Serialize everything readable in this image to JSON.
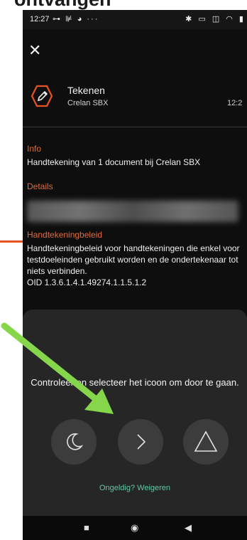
{
  "page": {
    "heading": "ontvangen"
  },
  "status_bar": {
    "time": "12:27",
    "left_icons": "⊶ ⊯ ◕ ···",
    "right_icons": "✱ ▭ ◫ ◠ ▮"
  },
  "request": {
    "title": "Tekenen",
    "subtitle": "Crelan SBX",
    "time": "12:2"
  },
  "info": {
    "label": "Info",
    "text": "Handtekening van 1 document bij Crelan SBX"
  },
  "details": {
    "label": "Details"
  },
  "policy": {
    "label": "Handtekeningbeleid",
    "text": "Handtekeningbeleid voor handtekeningen die enkel voor testdoeleinden gebruikt worden en de ondertekenaar tot niets verbinden.",
    "oid": "OID 1.3.6.1.4.1.49274.1.1.5.1.2"
  },
  "sheet": {
    "instruction": "Controleer en selecteer het icoon om door te gaan.",
    "choices": [
      "moon-icon",
      "chevron-right-icon",
      "triangle-icon"
    ],
    "reject_label": "Ongeldig? Weigeren"
  },
  "nav": {
    "recents": "■",
    "home": "◉",
    "back": "◀"
  },
  "colors": {
    "accent_orange": "#e06b3c",
    "link_green": "#5cc9a7",
    "annotation_arrow": "#86d64c"
  }
}
